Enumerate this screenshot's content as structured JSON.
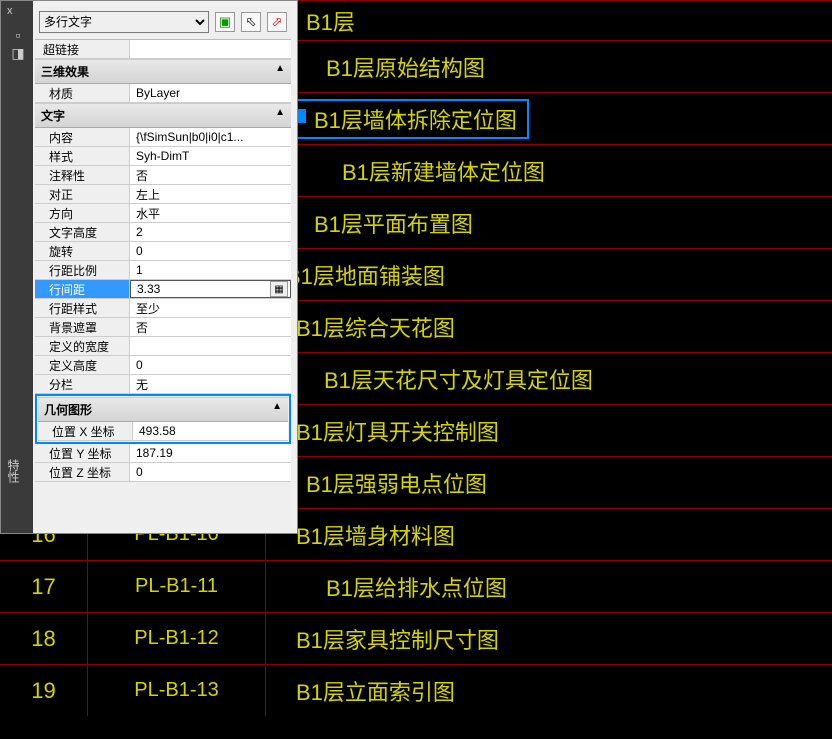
{
  "panel": {
    "close": "x",
    "vert_label": "特性",
    "selector": "多行文字",
    "icons": {
      "add": "▣",
      "qs": "⚡",
      "qs2": "⚡"
    },
    "hyperlink_row": {
      "label": "超链接",
      "value": ""
    },
    "group_3d": "三维效果",
    "row_material": {
      "label": "材质",
      "value": "ByLayer"
    },
    "group_text": "文字",
    "rows_text": {
      "content": {
        "label": "内容",
        "value": "{\\fSimSun|b0|i0|c1..."
      },
      "style": {
        "label": "样式",
        "value": "Syh-DimT"
      },
      "annotative": {
        "label": "注释性",
        "value": "否"
      },
      "justify": {
        "label": "对正",
        "value": "左上"
      },
      "direction": {
        "label": "方向",
        "value": "水平"
      },
      "height": {
        "label": "文字高度",
        "value": "2"
      },
      "rotate": {
        "label": "旋转",
        "value": "0"
      },
      "linescale": {
        "label": "行距比例",
        "value": "1"
      },
      "linespacing": {
        "label": "行间距",
        "value": "3.33"
      },
      "linestyle": {
        "label": "行距样式",
        "value": "至少"
      },
      "bgmask": {
        "label": "背景遮罩",
        "value": "否"
      },
      "defwidth": {
        "label": "定义的宽度",
        "value": ""
      },
      "defheight": {
        "label": "定义高度",
        "value": "0"
      },
      "columns": {
        "label": "分栏",
        "value": "无"
      }
    },
    "group_geo": "几何图形",
    "rows_geo": {
      "x": {
        "label": "位置 X 坐标",
        "value": "493.58"
      },
      "y": {
        "label": "位置 Y 坐标",
        "value": "187.19"
      },
      "z": {
        "label": "位置 Z 坐标",
        "value": "0"
      }
    }
  },
  "drawing": {
    "rows": [
      {
        "desc": "B1层"
      },
      {
        "desc": "B1层原始结构图"
      },
      {
        "desc": "B1层墙体拆除定位图",
        "selected": true
      },
      {
        "desc": "B1层新建墙体定位图"
      },
      {
        "desc": "B1层平面布置图"
      },
      {
        "desc": "B1层地面铺装图"
      },
      {
        "desc": "B1层综合天花图"
      },
      {
        "desc": "B1层天花尺寸及灯具定位图"
      },
      {
        "desc": "B1层灯具开关控制图"
      },
      {
        "desc": "B1层强弱电点位图"
      },
      {
        "desc": "B1层墙身材料图"
      },
      {
        "desc": "B1层给排水点位图"
      },
      {
        "desc": "B1层家具控制尺寸图"
      },
      {
        "desc": "B1层立面索引图"
      }
    ],
    "numbered": [
      {
        "num": "16",
        "code": "PL-B1-10"
      },
      {
        "num": "17",
        "code": "PL-B1-11"
      },
      {
        "num": "18",
        "code": "PL-B1-12"
      },
      {
        "num": "19",
        "code": "PL-B1-13"
      }
    ]
  }
}
